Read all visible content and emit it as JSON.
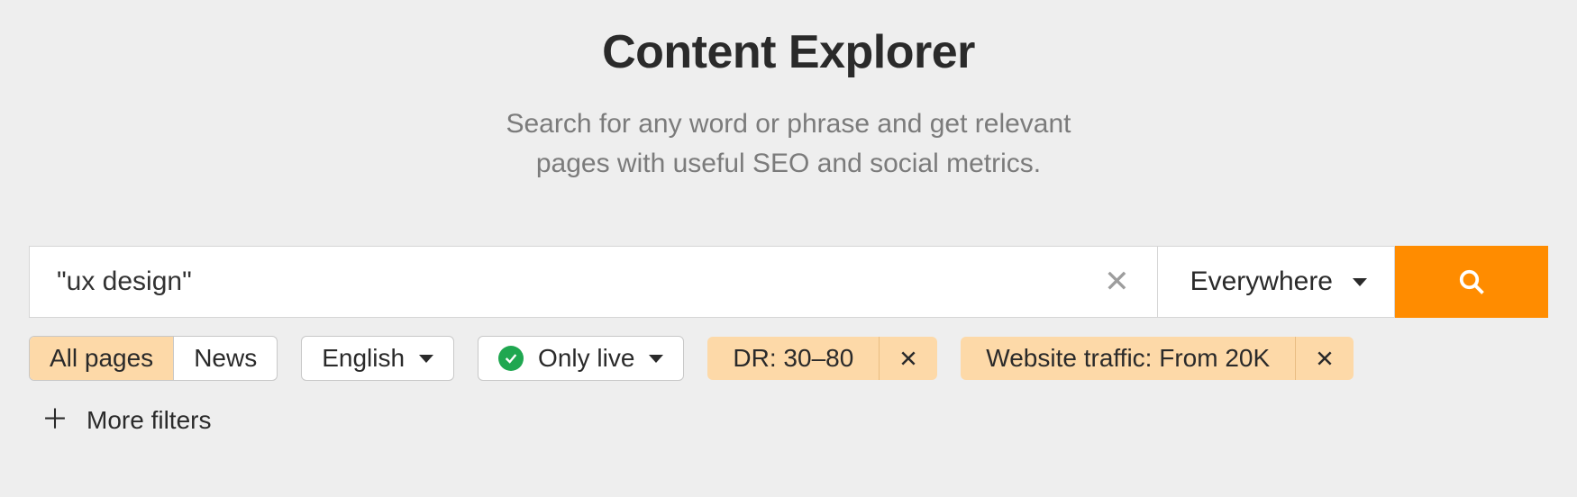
{
  "title": "Content Explorer",
  "subtitle_line1": "Search for any word or phrase and get relevant",
  "subtitle_line2": "pages with useful SEO and social metrics.",
  "search": {
    "value": "\"ux design\"",
    "scope": "Everywhere"
  },
  "tabs": {
    "all_pages": "All pages",
    "news": "News"
  },
  "filters": {
    "language": "English",
    "only_live": "Only live",
    "dr": "DR: 30–80",
    "website_traffic": "Website traffic: From 20K",
    "more": "More filters"
  }
}
